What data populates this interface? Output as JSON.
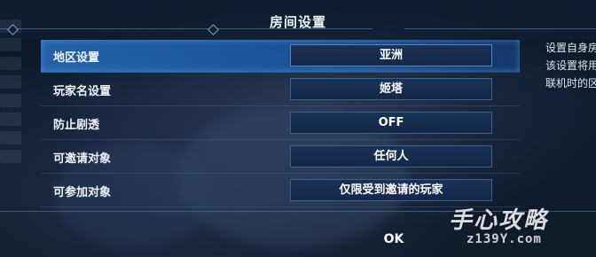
{
  "dialog": {
    "title": "房间设置",
    "ok_label": "OK"
  },
  "settings": [
    {
      "label": "地区设置",
      "value": "亚洲",
      "selected": true
    },
    {
      "label": "玩家名设置",
      "value": "姬塔",
      "selected": false
    },
    {
      "label": "防止剧透",
      "value": "OFF",
      "selected": false
    },
    {
      "label": "可邀请对象",
      "value": "任何人",
      "selected": false
    },
    {
      "label": "可参加对象",
      "value": "仅限受到邀请的玩家",
      "selected": false
    }
  ],
  "side_help": {
    "line1": "设置自身房",
    "line2": "该设置将用",
    "line3": "联机时的区"
  },
  "watermark": {
    "brand": "手心攻略",
    "site": "z139Y.com"
  }
}
